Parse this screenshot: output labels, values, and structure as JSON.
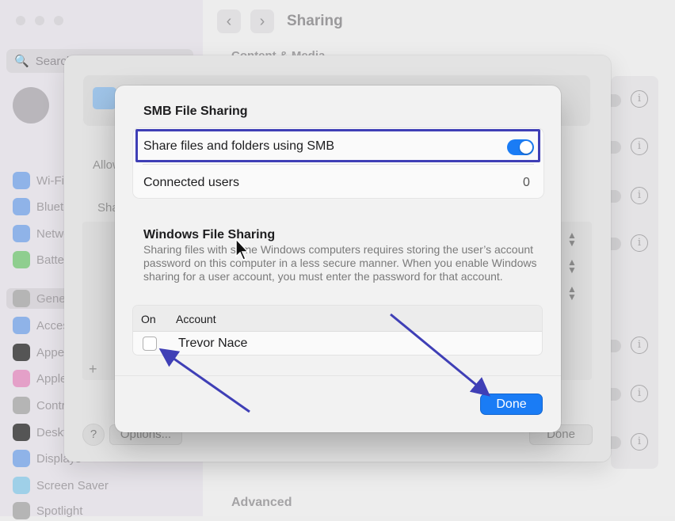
{
  "background": {
    "search_placeholder": "Search",
    "window_title": "Sharing",
    "section_content_media": "Content & Media",
    "section_advanced": "Advanced",
    "sidebar_items": [
      {
        "label": "Wi-Fi",
        "color": "#8fb3e8"
      },
      {
        "label": "Bluetooth",
        "color": "#8fb3e8"
      },
      {
        "label": "Network",
        "color": "#8fb3e8"
      },
      {
        "label": "Battery",
        "color": "#8fce8f"
      },
      {
        "label": "General",
        "color": "#b5b5b5"
      },
      {
        "label": "Accessibility",
        "color": "#8fb3e8"
      },
      {
        "label": "Appearance",
        "color": "#555555"
      },
      {
        "label": "Apple Intelligence",
        "color": "#e4a0c8"
      },
      {
        "label": "Control Center",
        "color": "#b5b5b5"
      },
      {
        "label": "Desktop & Dock",
        "color": "#555555"
      },
      {
        "label": "Displays",
        "color": "#8fb3e8"
      },
      {
        "label": "Screen Saver",
        "color": "#9fd0e8"
      },
      {
        "label": "Spotlight",
        "color": "#b5b5b5"
      }
    ],
    "sheet": {
      "allow_label": "Allow",
      "shared_label": "Shared Folders",
      "options_button": "Options...",
      "done_button": "Done",
      "help_button": "?",
      "add_button": "+"
    }
  },
  "dialog": {
    "title": "SMB File Sharing",
    "smb_toggle_label": "Share files and folders using SMB",
    "smb_enabled": true,
    "connected_users_label": "Connected users",
    "connected_users_count": "0",
    "windows_title": "Windows File Sharing",
    "windows_description": "Sharing files with some Windows computers requires storing the user’s account password on this computer in a less secure manner. When you enable Windows sharing for a user account, you must enter the password for that account.",
    "table": {
      "columns": [
        "On",
        "Account"
      ],
      "rows": [
        {
          "on": false,
          "account": "Trevor Nace"
        }
      ]
    },
    "done_button": "Done"
  },
  "colors": {
    "accent": "#1a7cf5",
    "annotation": "#3f3fb6"
  }
}
